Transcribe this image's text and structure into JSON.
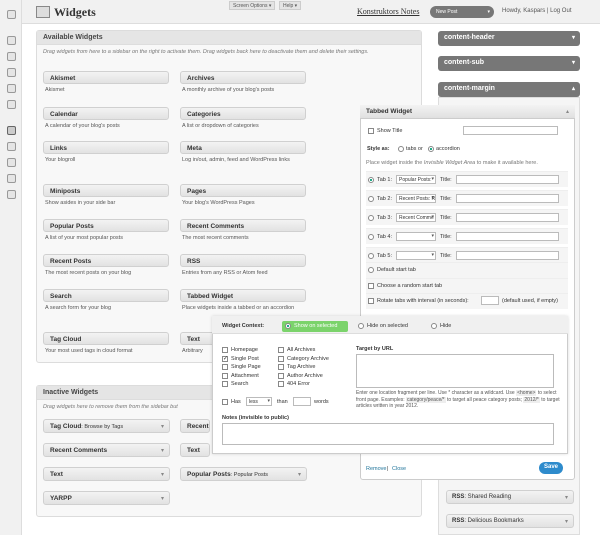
{
  "header": {
    "title": "Widgets",
    "screen_options": "Screen Options ▾",
    "help": "Help ▾",
    "site_name": "Konstruktors Notes",
    "new_post": "New Post",
    "howdy": "Howdy, Kaspars | Log Out"
  },
  "available": {
    "title": "Available Widgets",
    "description": "Drag widgets from here to a sidebar on the right to activate them. Drag widgets back here to deactivate them and delete their settings.",
    "widgets": [
      {
        "name": "Akismet",
        "desc": "Akismet"
      },
      {
        "name": "Archives",
        "desc": "A monthly archive of your blog's posts"
      },
      {
        "name": "Calendar",
        "desc": "A calendar of your blog's posts"
      },
      {
        "name": "Categories",
        "desc": "A list or dropdown of categories"
      },
      {
        "name": "Links",
        "desc": "Your blogroll"
      },
      {
        "name": "Meta",
        "desc": "Log in/out, admin, feed and WordPress links"
      },
      {
        "name": "Miniposts",
        "desc": "Show asides in your side bar"
      },
      {
        "name": "Pages",
        "desc": "Your blog's WordPress Pages"
      },
      {
        "name": "Popular Posts",
        "desc": "A list of your most popular posts"
      },
      {
        "name": "Recent Comments",
        "desc": "The most recent comments"
      },
      {
        "name": "Recent Posts",
        "desc": "The most recent posts on your blog"
      },
      {
        "name": "RSS",
        "desc": "Entries from any RSS or Atom feed"
      },
      {
        "name": "Search",
        "desc": "A search form for your blog"
      },
      {
        "name": "Tabbed Widget",
        "desc": "Place widgets inside a tabbed or an accordion"
      },
      {
        "name": "Tag Cloud",
        "desc": "Your most used tags in cloud format"
      },
      {
        "name": "Text",
        "desc": "Arbitrary"
      }
    ]
  },
  "inactive": {
    "title": "Inactive Widgets",
    "description": "Drag widgets here to remove them from the sidebar but",
    "widgets": [
      {
        "name": "Tag Cloud",
        "sub": ": Browse by Tags"
      },
      {
        "name": "Recent",
        "sub": ""
      },
      {
        "name": "Recent Comments",
        "sub": ""
      },
      {
        "name": "Text",
        "sub": ""
      },
      {
        "name": "Text",
        "sub": ""
      },
      {
        "name": "Popular Posts",
        "sub": ": Popular Posts"
      },
      {
        "name": "YARPP",
        "sub": ""
      }
    ]
  },
  "sidebars": [
    {
      "name": "content-header"
    },
    {
      "name": "content-sub"
    },
    {
      "name": "content-margin"
    }
  ],
  "sidebar_widgets_bottom": [
    {
      "name": "RSS",
      "sub": ": Shared Reading"
    },
    {
      "name": "RSS",
      "sub": ": Delicious Bookmarks"
    }
  ],
  "tabbed": {
    "title": "Tabbed Widget",
    "show_title": "Show Title",
    "style_as": "Style as:",
    "tabs_or": "tabs or",
    "accordion": "accordion",
    "hint_prefix": "Place widget inside the ",
    "hint_em": "Invisible Widget Area",
    "hint_suffix": " to make it available here.",
    "title_label": "Title:",
    "tabs": [
      {
        "label": "Tab 1:",
        "widget": "Popular Posts:"
      },
      {
        "label": "Tab 2:",
        "widget": "Recent Posts: R"
      },
      {
        "label": "Tab 3:",
        "widget": "Recent Comme"
      },
      {
        "label": "Tab 4:",
        "widget": ""
      },
      {
        "label": "Tab 5:",
        "widget": ""
      }
    ],
    "default_start": "Default start tab",
    "random_start": "Choose a random start tab",
    "rotate": "Rotate tabs with interval (in seconds):",
    "rotate_hint": "(default used, if empty)",
    "remove": "Remove",
    "close": "Close",
    "separator": "|",
    "save": "Save"
  },
  "context": {
    "label": "Widget Context:",
    "show_on_selected": "Show on selected",
    "hide_on_selected": "Hide on selected",
    "hide": "Hide",
    "checks_left": [
      "Homepage",
      "Single Post",
      "Single Page",
      "Attachment",
      "Search"
    ],
    "checks_right": [
      "All Archives",
      "Category Archive",
      "Tag Archive",
      "Author Archive",
      "404 Error"
    ],
    "has": "Has",
    "less": "less",
    "than": "than",
    "words": "words",
    "target_by_url": "Target by URL",
    "url_help_1": "Enter one location fragment per line. Use * character as a wildcard. Use",
    "url_code_1": "<home>",
    "url_help_2": " to select front page. Examples: ",
    "url_code_2": "category/peace/*",
    "url_help_3": " to target all",
    "url_help_4": "peace category posts; ",
    "url_code_3": "2012/*",
    "url_help_5": " to target articles written in year 2012.",
    "notes": "Notes (invisible to public)"
  },
  "colors": {
    "accent": "#21759b",
    "show_selected": "#7bd36b",
    "save": "#2e8bcc",
    "sidebar": "#777777"
  }
}
